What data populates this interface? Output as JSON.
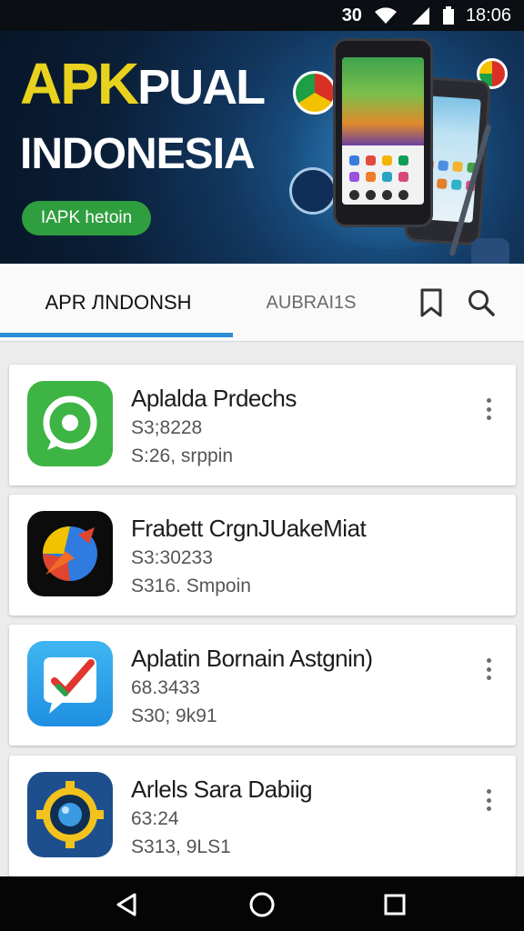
{
  "status_bar": {
    "time": "18:06",
    "indicator_text": "30",
    "icons": [
      "wifi-icon",
      "signal-icon",
      "battery-icon"
    ]
  },
  "banner": {
    "title_accent": "APK",
    "title_rest": "PUAL",
    "subtitle": "INDONESIA",
    "pill_label": "IAPK hetoin"
  },
  "tabs": [
    {
      "label": "APR ЛNDONSH",
      "active": true
    },
    {
      "label": "AUBRAI1S",
      "active": false
    }
  ],
  "toolbar_icons": [
    "bookmark-icon",
    "search-icon"
  ],
  "apps": [
    {
      "title": "Aplalda Prdechs",
      "line1": "S3;8228",
      "line2": "S:26, srppin",
      "icon": "whatsapp-style-icon",
      "has_more": true
    },
    {
      "title": "Frabett CrgnJUakeMiat",
      "line1": "S3:30233",
      "line2": "S316. Smpoin",
      "icon": "browser-style-icon",
      "has_more": false
    },
    {
      "title": "Aplatin Bornain Astgnin)",
      "line1": "68.3433",
      "line2": "S30; 9k91",
      "icon": "checkmark-chat-icon",
      "has_more": true
    },
    {
      "title": "Arlels Sara Dabiig",
      "line1": "63:24",
      "line2": "S313, 9LS1",
      "icon": "gear-camera-icon",
      "has_more": true
    }
  ],
  "colors": {
    "accent_blue": "#2d8cd6",
    "banner_yellow": "#e8d21d",
    "pill_green": "#2f9e3f"
  },
  "nav_icons": [
    "back-icon",
    "home-icon",
    "recents-icon"
  ]
}
